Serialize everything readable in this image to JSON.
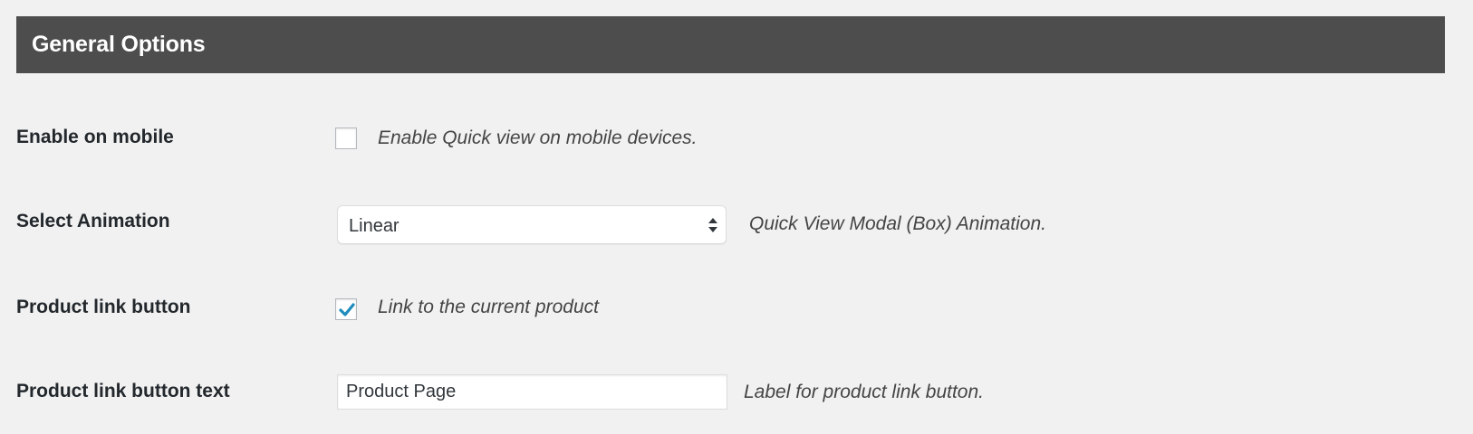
{
  "section": {
    "title": "General Options"
  },
  "rows": {
    "mobile": {
      "label": "Enable on mobile",
      "checked": false,
      "description": "Enable Quick view on mobile devices."
    },
    "animation": {
      "label": "Select Animation",
      "selected_value": "Linear",
      "description": "Quick View Modal (Box) Animation."
    },
    "product_link": {
      "label": "Product link button",
      "checked": true,
      "description": "Link to the current product"
    },
    "product_link_text": {
      "label": "Product link button text",
      "value": "Product Page",
      "description": "Label for product link button."
    }
  },
  "colors": {
    "header_bg": "#4d4d4d",
    "page_bg": "#f1f1f1",
    "checkmark": "#1e8cbe"
  },
  "icons": {
    "checkmark": "checkmark-icon",
    "select_arrows": "select-arrows-icon"
  }
}
